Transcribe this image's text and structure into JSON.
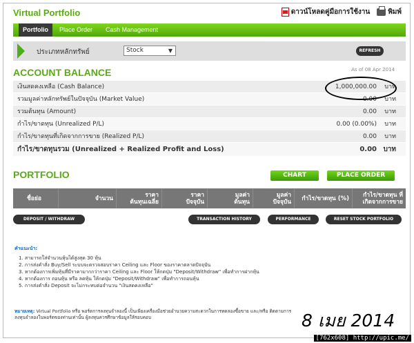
{
  "app": {
    "title": "Virtual Portfolio"
  },
  "top_links": {
    "download_manual": "ดาวน์โหลดคู่มือการใช้งาน",
    "print": "พิมพ์"
  },
  "nav": [
    "Portfolio",
    "Place Order",
    "Cash Management"
  ],
  "filter": {
    "label": "ประเภทหลักทรัพย์",
    "selected": "Stock",
    "refresh": "REFRESH"
  },
  "account": {
    "title": "ACCOUNT BALANCE",
    "as_of": "As of 08 Apr 2014",
    "rows": [
      {
        "label": "เงินสดคงเหลือ (Cash Balance)",
        "value": "1,000,000.00",
        "unit": "บาท"
      },
      {
        "label": "รวมมูลค่าหลักทรัพย์ในปัจจุบัน (Market Value)",
        "value": "0.00",
        "unit": "บาท"
      },
      {
        "label": "รวมต้นทุน (Amount)",
        "value": "0.00",
        "unit": "บาท"
      },
      {
        "label": "กำไร/ขาดทุน (Unrealized P/L)",
        "value": "0.00 (0.00%)",
        "unit": "บาท"
      },
      {
        "label": "กำไร/ขาดทุนที่เกิดจากการขาย (Realized P/L)",
        "value": "0.00",
        "unit": "บาท"
      },
      {
        "label": "กำไร/ขาดทุนรวม (Unrealized + Realized Profit and Loss)",
        "value": "0.00",
        "unit": "บาท"
      }
    ]
  },
  "portfolio": {
    "title": "PORTFOLIO",
    "chart_button": "CHART",
    "place_order_button": "PLACE ORDER",
    "columns": [
      "ชื่อย่อ",
      "จำนวน",
      "ราคา\nต้นทุนเฉลี่ย",
      "ราคา\nปัจจุบัน",
      "มูลค่า\nต้นทุน",
      "มูลค่า\nปัจจุบัน",
      "กำไร/ขาดทุน (%)",
      "กำไร/ขาดทุน ที่\nเกิดจากการขาย"
    ],
    "actions": [
      "DEPOSIT / WITHDRAW",
      "TRANSACTION HISTORY",
      "PERFORMANCE",
      "RESET STOCK PORTFOLIO"
    ]
  },
  "notes": {
    "title": "คำแนะนำ:",
    "items": [
      "1.  สามารถใส่จำนวนหุ้นได้สูงสุด 30 หุ้น",
      "2.  การส่งคำสั่ง Buy/Sell ระบบจะตรวจสอบราคา Ceiling และ Floor ของราคาตลาดปัจจุบัน",
      "3.  หากต้องการเพิ่มหุ้นที่มีราคามากกว่าราคา Ceiling และ Floor ให้กดปุ่ม \"Deposit/Withdraw\" เพื่อทำการฝากหุ้น",
      "4.  หากต้องการ ถอนหุ้น หรือ ลดหุ้น ให้กดปุ่ม \"Deposit/Withdraw\" เพื่อทำการถอนหุ้น",
      "5.  การส่งคำสั่ง Deposit จะไม่กระทบต่อจำนวน \"เงินสดคงเหลือ\""
    ]
  },
  "disclaimer": {
    "label": "หมายเหตุ:",
    "text": "Virtual Portfolio หรือ พอร์ตการลงทุนจำลองนี้ เป็นเพียงเครื่องมือช่วยอำนวยความสะดวกในการทดลองซื้อขาย และ/หรือ ติดตามการลงทุนจำลองในพอร์ตของท่านเท่านั้น ผู้ลงทุนควรศึกษาข้อมูลให้รอบคอบ"
  },
  "date_stamp": "8 เมย 2014",
  "watermark": "[762x608] http://upic.me/"
}
